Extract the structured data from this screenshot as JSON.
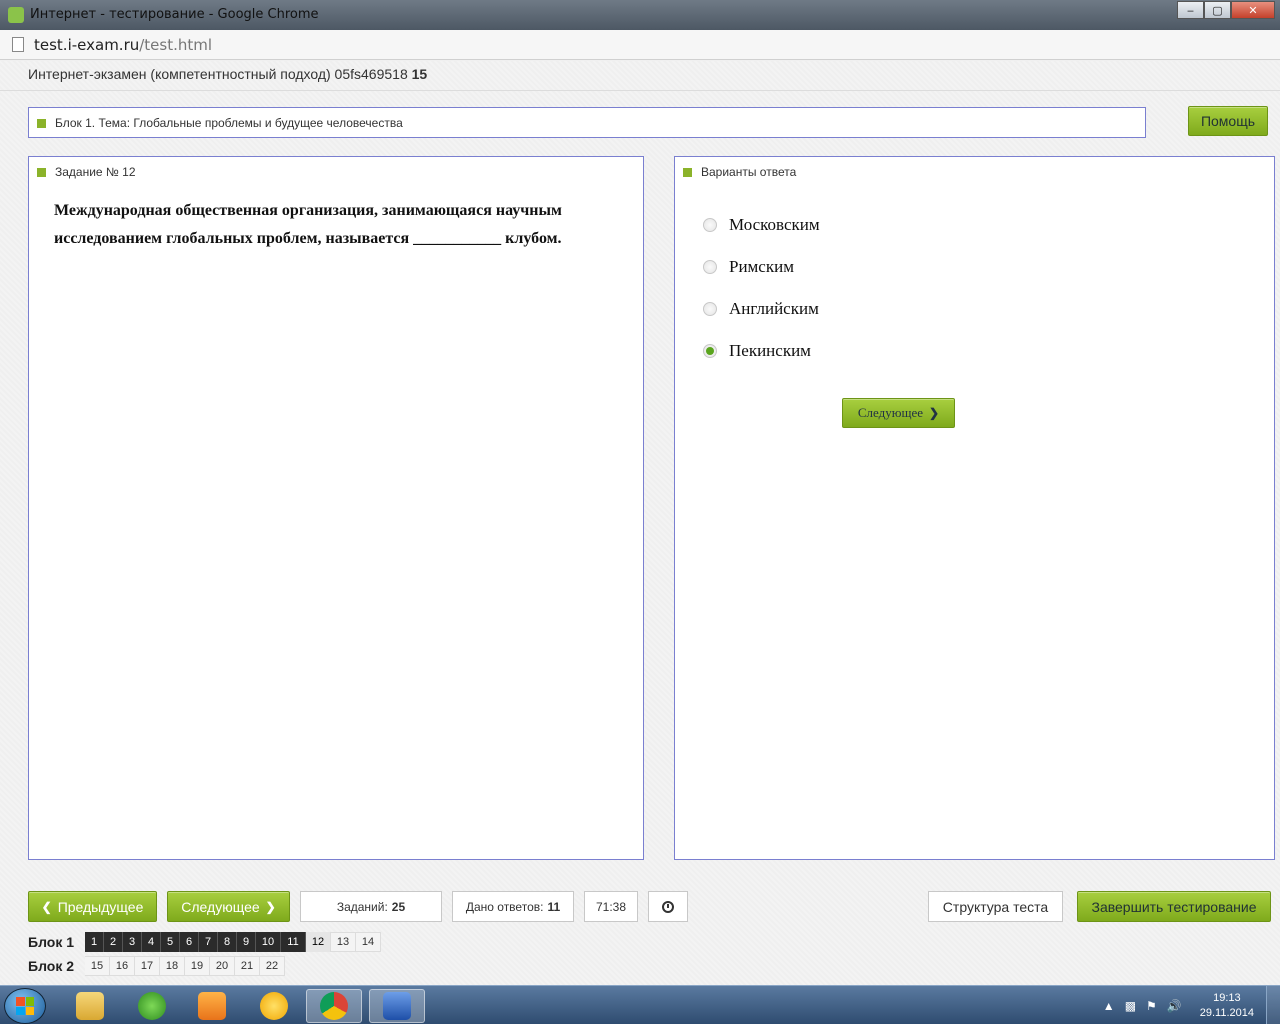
{
  "window": {
    "title": "Интернет - тестирование - Google Chrome",
    "controls": {
      "minimize": "‒",
      "maximize": "▢",
      "close": "✕"
    }
  },
  "address_bar": {
    "domain": "test.i-exam.ru",
    "path": "/test.html"
  },
  "exam": {
    "title": "Интернет-экзамен (компетентностный подход) 05fs469518",
    "title_num": "15"
  },
  "topic": {
    "label": "Блок 1. Тема: Глобальные проблемы и будущее человечества"
  },
  "help_button": "Помощь",
  "task": {
    "title": "Задание № 12",
    "question": "Международная общественная организация, занимающаяся научным исследованием глобальных проблем, называется ___________ клубом."
  },
  "answers": {
    "title": "Варианты ответа",
    "options": [
      {
        "label": "Московским",
        "selected": false
      },
      {
        "label": "Римским",
        "selected": false
      },
      {
        "label": "Английским",
        "selected": false
      },
      {
        "label": "Пекинским",
        "selected": true
      }
    ],
    "next_inline": "Следующее"
  },
  "controls": {
    "prev": "Предыдущее",
    "next": "Следующее",
    "tasks_label": "Заданий:",
    "tasks_value": "25",
    "answered_label": "Дано ответов:",
    "answered_value": "11",
    "timer": "71:38",
    "structure": "Структура теста",
    "finish": "Завершить тестирование"
  },
  "blocks": [
    {
      "label": "Блок 1",
      "items": [
        {
          "n": "1",
          "state": "answered"
        },
        {
          "n": "2",
          "state": "answered"
        },
        {
          "n": "3",
          "state": "answered"
        },
        {
          "n": "4",
          "state": "answered"
        },
        {
          "n": "5",
          "state": "answered"
        },
        {
          "n": "6",
          "state": "answered"
        },
        {
          "n": "7",
          "state": "answered"
        },
        {
          "n": "8",
          "state": "answered"
        },
        {
          "n": "9",
          "state": "answered"
        },
        {
          "n": "10",
          "state": "answered"
        },
        {
          "n": "11",
          "state": "answered"
        },
        {
          "n": "12",
          "state": "current"
        },
        {
          "n": "13",
          "state": "pending"
        },
        {
          "n": "14",
          "state": "pending"
        }
      ]
    },
    {
      "label": "Блок 2",
      "items": [
        {
          "n": "15",
          "state": "pending"
        },
        {
          "n": "16",
          "state": "pending"
        },
        {
          "n": "17",
          "state": "pending"
        },
        {
          "n": "18",
          "state": "pending"
        },
        {
          "n": "19",
          "state": "pending"
        },
        {
          "n": "20",
          "state": "pending"
        },
        {
          "n": "21",
          "state": "pending"
        },
        {
          "n": "22",
          "state": "pending"
        }
      ]
    }
  ],
  "taskbar": {
    "apps": [
      "file-explorer-icon",
      "utorrent-icon",
      "media-player-icon",
      "mail-agent-icon",
      "chrome-icon",
      "word-icon"
    ],
    "active_app": "chrome-icon",
    "time": "19:13",
    "date": "29.11.2014"
  },
  "colors": {
    "accent_green": "#8bb32a",
    "panel_border": "#7a7fd0",
    "selected_radio": "#5aa51e"
  }
}
